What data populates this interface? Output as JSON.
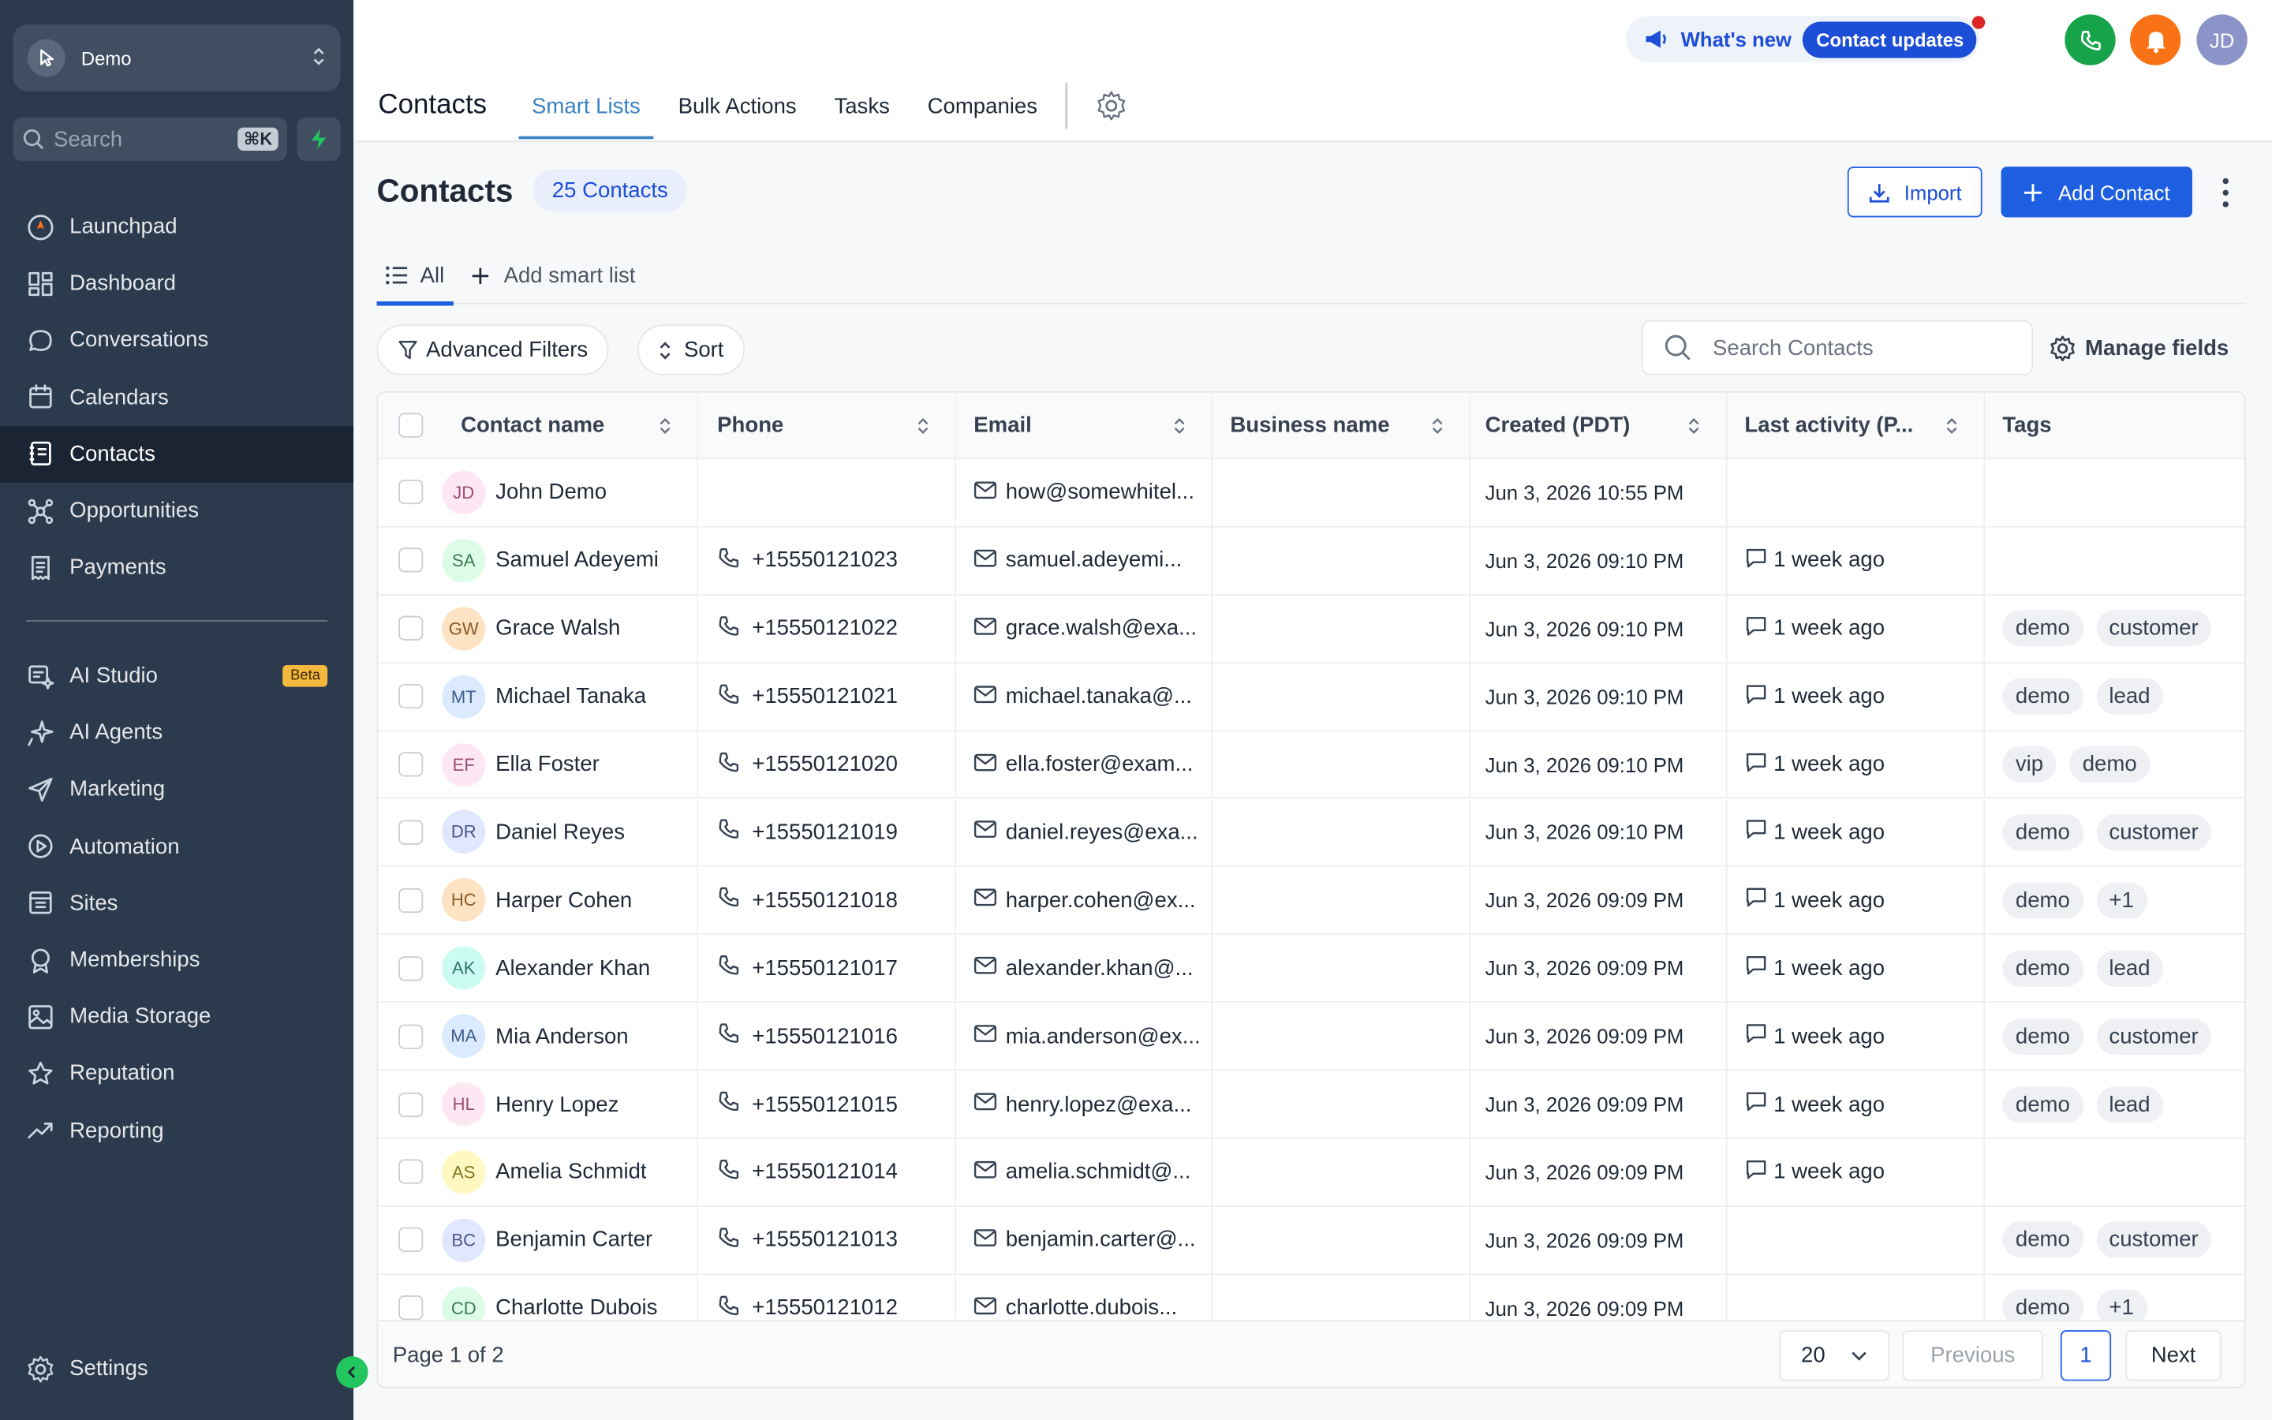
{
  "sidebar": {
    "account": "Demo",
    "search_placeholder": "Search",
    "search_shortcut": "⌘K",
    "nav_top": [
      {
        "label": "Launchpad",
        "icon": "launchpad-icon"
      },
      {
        "label": "Dashboard",
        "icon": "dashboard-icon"
      },
      {
        "label": "Conversations",
        "icon": "chat-icon"
      },
      {
        "label": "Calendars",
        "icon": "calendar-icon"
      },
      {
        "label": "Contacts",
        "icon": "contacts-icon",
        "active": true
      },
      {
        "label": "Opportunities",
        "icon": "opportunities-icon"
      },
      {
        "label": "Payments",
        "icon": "receipt-icon"
      }
    ],
    "nav_bottom": [
      {
        "label": "AI Studio",
        "icon": "ai-studio-icon",
        "badge": "Beta"
      },
      {
        "label": "AI Agents",
        "icon": "sparkle-icon"
      },
      {
        "label": "Marketing",
        "icon": "send-icon"
      },
      {
        "label": "Automation",
        "icon": "automation-icon"
      },
      {
        "label": "Sites",
        "icon": "sites-icon"
      },
      {
        "label": "Memberships",
        "icon": "award-icon"
      },
      {
        "label": "Media Storage",
        "icon": "image-icon"
      },
      {
        "label": "Reputation",
        "icon": "star-icon"
      },
      {
        "label": "Reporting",
        "icon": "trend-icon"
      }
    ],
    "settings_label": "Settings"
  },
  "header": {
    "whats_new": "What's new",
    "updates_pill": "Contact updates",
    "user_initials": "JD",
    "brand": "Contacts",
    "tabs": [
      "Smart Lists",
      "Bulk Actions",
      "Tasks",
      "Companies"
    ],
    "active_tab": "Smart Lists"
  },
  "page": {
    "title": "Contacts",
    "count": "25 Contacts",
    "import_label": "Import",
    "add_label": "Add Contact",
    "list_all": "All",
    "add_smart_list": "Add smart list",
    "advanced_filters": "Advanced Filters",
    "sort": "Sort",
    "search_placeholder": "Search Contacts",
    "manage_fields": "Manage fields"
  },
  "table": {
    "columns": [
      "Contact name",
      "Phone",
      "Email",
      "Business name",
      "Created (PDT)",
      "Last activity (P...",
      "Tags"
    ],
    "rows": [
      {
        "initials": "JD",
        "avatar_bg": "#fce7f3",
        "avatar_fg": "#9d4b73",
        "name": "John Demo",
        "phone": "",
        "email": "how@somewhitel...",
        "business": "",
        "created": "Jun 3, 2026 10:55 PM",
        "activity": "",
        "tags": []
      },
      {
        "initials": "SA",
        "avatar_bg": "#dcfce7",
        "avatar_fg": "#3f7a52",
        "name": "Samuel Adeyemi",
        "phone": "+15550121023",
        "email": "samuel.adeyemi...",
        "business": "",
        "created": "Jun 3, 2026 09:10 PM",
        "activity": "1 week ago",
        "tags": []
      },
      {
        "initials": "GW",
        "avatar_bg": "#fde2c4",
        "avatar_fg": "#8a5a23",
        "name": "Grace Walsh",
        "phone": "+15550121022",
        "email": "grace.walsh@exa...",
        "business": "",
        "created": "Jun 3, 2026 09:10 PM",
        "activity": "1 week ago",
        "tags": [
          "demo",
          "customer"
        ]
      },
      {
        "initials": "MT",
        "avatar_bg": "#dbeafe",
        "avatar_fg": "#3d5f8e",
        "name": "Michael Tanaka",
        "phone": "+15550121021",
        "email": "michael.tanaka@...",
        "business": "",
        "created": "Jun 3, 2026 09:10 PM",
        "activity": "1 week ago",
        "tags": [
          "demo",
          "lead"
        ]
      },
      {
        "initials": "EF",
        "avatar_bg": "#fce7f3",
        "avatar_fg": "#9d4b73",
        "name": "Ella Foster",
        "phone": "+15550121020",
        "email": "ella.foster@exam...",
        "business": "",
        "created": "Jun 3, 2026 09:10 PM",
        "activity": "1 week ago",
        "tags": [
          "vip",
          "demo"
        ]
      },
      {
        "initials": "DR",
        "avatar_bg": "#e0e7ff",
        "avatar_fg": "#4b5589",
        "name": "Daniel Reyes",
        "phone": "+15550121019",
        "email": "daniel.reyes@exa...",
        "business": "",
        "created": "Jun 3, 2026 09:10 PM",
        "activity": "1 week ago",
        "tags": [
          "demo",
          "customer"
        ]
      },
      {
        "initials": "HC",
        "avatar_bg": "#fde2c4",
        "avatar_fg": "#8a5a23",
        "name": "Harper Cohen",
        "phone": "+15550121018",
        "email": "harper.cohen@ex...",
        "business": "",
        "created": "Jun 3, 2026 09:09 PM",
        "activity": "1 week ago",
        "tags": [
          "demo",
          "+1"
        ]
      },
      {
        "initials": "AK",
        "avatar_bg": "#ccfbf1",
        "avatar_fg": "#2f766b",
        "name": "Alexander Khan",
        "phone": "+15550121017",
        "email": "alexander.khan@...",
        "business": "",
        "created": "Jun 3, 2026 09:09 PM",
        "activity": "1 week ago",
        "tags": [
          "demo",
          "lead"
        ]
      },
      {
        "initials": "MA",
        "avatar_bg": "#dbeafe",
        "avatar_fg": "#3d5f8e",
        "name": "Mia Anderson",
        "phone": "+15550121016",
        "email": "mia.anderson@ex...",
        "business": "",
        "created": "Jun 3, 2026 09:09 PM",
        "activity": "1 week ago",
        "tags": [
          "demo",
          "customer"
        ]
      },
      {
        "initials": "HL",
        "avatar_bg": "#fce7f3",
        "avatar_fg": "#9d4b73",
        "name": "Henry Lopez",
        "phone": "+15550121015",
        "email": "henry.lopez@exa...",
        "business": "",
        "created": "Jun 3, 2026 09:09 PM",
        "activity": "1 week ago",
        "tags": [
          "demo",
          "lead"
        ]
      },
      {
        "initials": "AS",
        "avatar_bg": "#fef9c3",
        "avatar_fg": "#857320",
        "name": "Amelia Schmidt",
        "phone": "+15550121014",
        "email": "amelia.schmidt@...",
        "business": "",
        "created": "Jun 3, 2026 09:09 PM",
        "activity": "1 week ago",
        "tags": []
      },
      {
        "initials": "BC",
        "avatar_bg": "#e0e7ff",
        "avatar_fg": "#4b5589",
        "name": "Benjamin Carter",
        "phone": "+15550121013",
        "email": "benjamin.carter@...",
        "business": "",
        "created": "Jun 3, 2026 09:09 PM",
        "activity": "",
        "tags": [
          "demo",
          "customer"
        ]
      },
      {
        "initials": "CD",
        "avatar_bg": "#dcfce7",
        "avatar_fg": "#3f7a52",
        "name": "Charlotte Dubois",
        "phone": "+15550121012",
        "email": "charlotte.dubois...",
        "business": "",
        "created": "Jun 3, 2026 09:09 PM",
        "activity": "",
        "tags": [
          "demo",
          "+1"
        ]
      }
    ]
  },
  "pager": {
    "info": "Page 1 of 2",
    "page_size": "20",
    "previous": "Previous",
    "current": "1",
    "next": "Next"
  },
  "colors": {
    "sidebar_bg": "#2c3a4d",
    "primary": "#1d5fe0",
    "phone_green": "#16a34a",
    "bell_orange": "#f97316",
    "avatar_purple": "#8b93c9"
  }
}
